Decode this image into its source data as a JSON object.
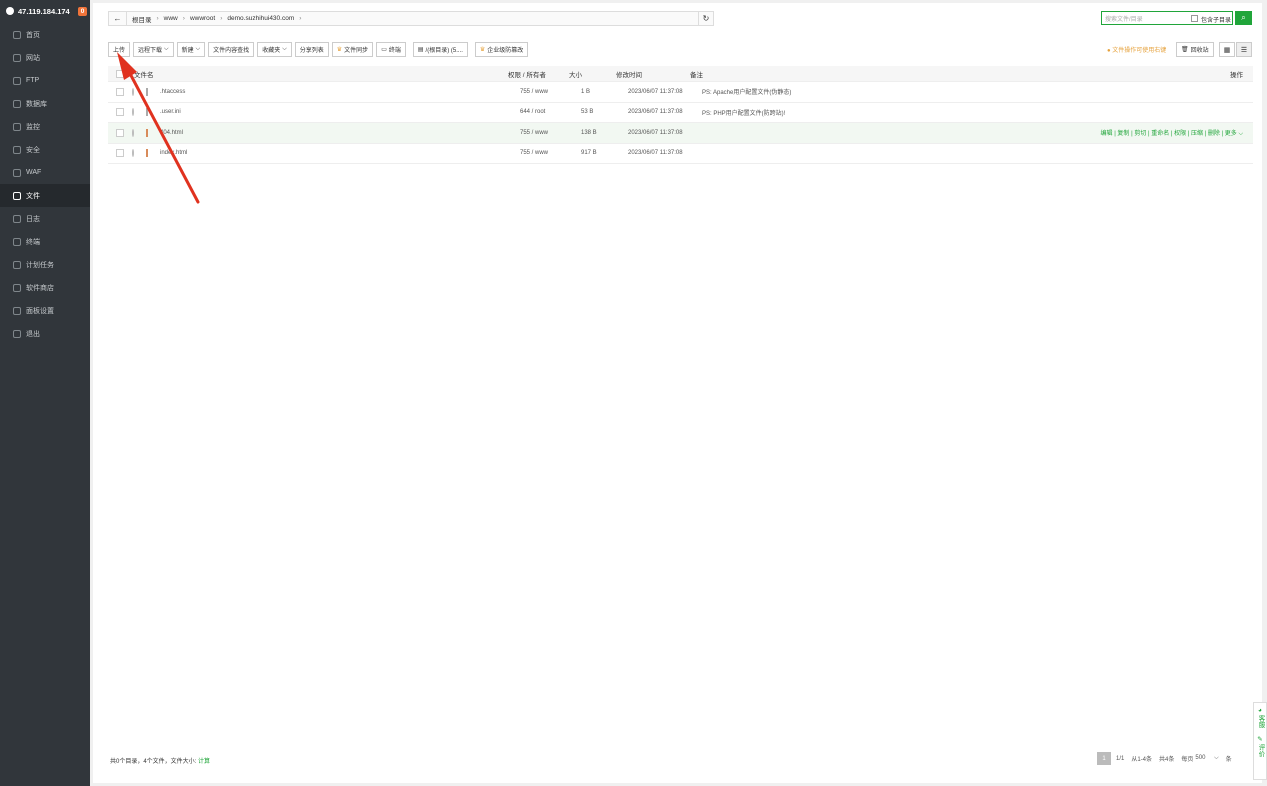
{
  "sidebar": {
    "server_ip": "47.119.184.174",
    "badge": "0",
    "items": [
      {
        "label": "首页"
      },
      {
        "label": "网站"
      },
      {
        "label": "FTP"
      },
      {
        "label": "数据库"
      },
      {
        "label": "监控"
      },
      {
        "label": "安全"
      },
      {
        "label": "WAF"
      },
      {
        "label": "文件"
      },
      {
        "label": "日志"
      },
      {
        "label": "终端"
      },
      {
        "label": "计划任务"
      },
      {
        "label": "软件商店"
      },
      {
        "label": "面板设置"
      },
      {
        "label": "退出"
      }
    ]
  },
  "path": {
    "back": "←",
    "crumbs": [
      "根目录",
      "www",
      "wwwroot",
      "demo.suzhihui430.com"
    ],
    "separator": "›",
    "refresh": "↻"
  },
  "search": {
    "placeholder": "搜索文件/目录",
    "include_sub": "包含子目录",
    "icon": "⌕"
  },
  "toolbar": {
    "upload": "上传",
    "remote_download": "远程下载",
    "new": "新建",
    "content_search": "文件内容查找",
    "favorites": "收藏夹",
    "share_list": "分享列表",
    "file_sync": "文件同步",
    "terminal": "终端",
    "root_dir": "/(根目录) (5....",
    "tamper": "企业级防篡改",
    "tip": "文件操作可使用右键",
    "recycle": "回收站"
  },
  "table": {
    "headers": {
      "name": "文件名",
      "perm": "权限 / 所有者",
      "size": "大小",
      "time": "修改时间",
      "note": "备注",
      "ops": "操作"
    },
    "rows": [
      {
        "name": ".htaccess",
        "perm": "755 / www",
        "size": "1 B",
        "time": "2023/06/07 11:37:08",
        "note": "PS: Apache用户配置文件(伪静态)"
      },
      {
        "name": ".user.ini",
        "perm": "644 / root",
        "size": "53 B",
        "time": "2023/06/07 11:37:08",
        "note": "PS: PHP用户配置文件(防跨站)!"
      },
      {
        "name": "404.html",
        "perm": "755 / www",
        "size": "138 B",
        "time": "2023/06/07 11:37:08",
        "note": ""
      },
      {
        "name": "index.html",
        "perm": "755 / www",
        "size": "917 B",
        "time": "2023/06/07 11:37:08",
        "note": ""
      }
    ],
    "row_actions": "编辑 | 复制 | 剪切 | 重命名 | 权限 | 压缩 | 删除 | 更多"
  },
  "footer": {
    "summary": "共0个目录，4个文件，文件大小: ",
    "calc": "计算",
    "page": "1",
    "pages": "1/1",
    "range": "从1-4条",
    "total": "共4条",
    "per_page": "每页",
    "per_page_value": "500",
    "trailing": "条"
  },
  "float_tab": {
    "kefu": "客服",
    "pingjia": "评价"
  },
  "colors": {
    "accent": "#20a53a",
    "sidebar": "#31363b",
    "arrow": "#e0321f"
  }
}
